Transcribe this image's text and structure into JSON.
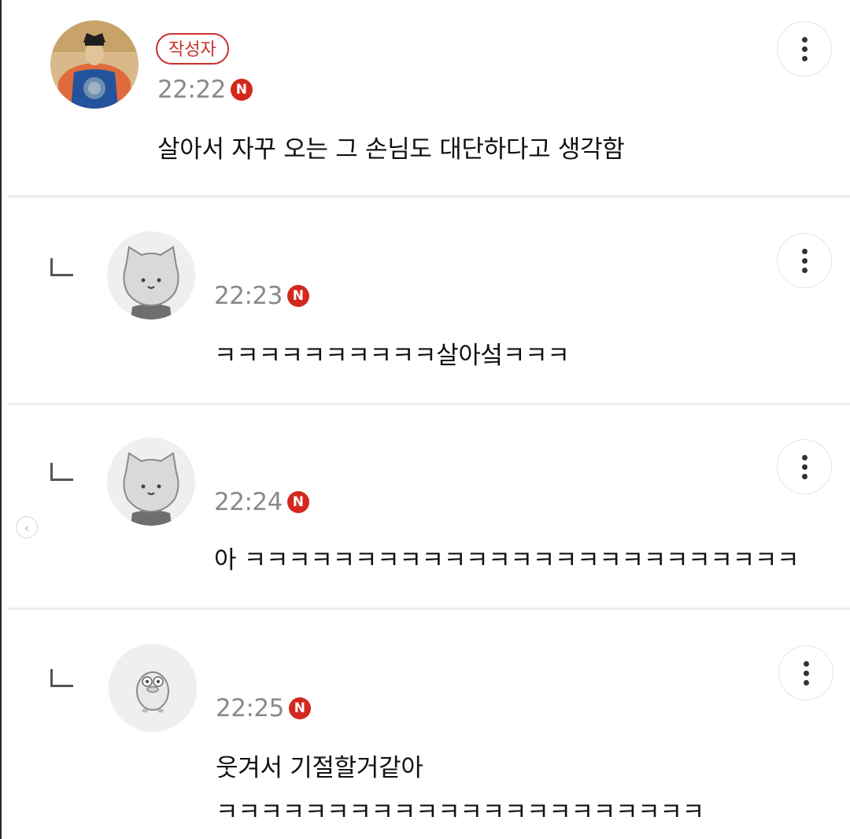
{
  "author_badge": "작성자",
  "new_badge": "N",
  "comments": [
    {
      "time": "22:22",
      "text": "살아서 자꾸 오는 그 손님도 대단하다고 생각함",
      "is_author": true,
      "is_reply": false
    },
    {
      "time": "22:23",
      "text": "ㅋㅋㅋㅋㅋㅋㅋㅋㅋㅋ살아섴ㅋㅋㅋ",
      "is_author": false,
      "is_reply": true
    },
    {
      "time": "22:24",
      "text": "아 ㅋㅋㅋㅋㅋㅋㅋㅋㅋㅋㅋㅋㅋㅋㅋㅋㅋㅋㅋㅋㅋㅋㅋㅋㅋ",
      "is_author": false,
      "is_reply": true
    },
    {
      "time": "22:25",
      "text": "웃겨서 기절할거같아",
      "text2": "ㅋㅋㅋㅋㅋㅋㅋㅋㅋㅋㅋㅋㅋㅋㅋㅋㅋㅋㅋㅋㅋㅋ",
      "is_author": false,
      "is_reply": true
    }
  ],
  "icons": {
    "more": "more-vertical-icon",
    "reply": "reply-corner-icon",
    "prev": "chevron-left-icon"
  },
  "colors": {
    "accent": "#c9302c",
    "new_badge": "#d3281e",
    "time": "#8a8a8a",
    "divider": "#ececec"
  }
}
